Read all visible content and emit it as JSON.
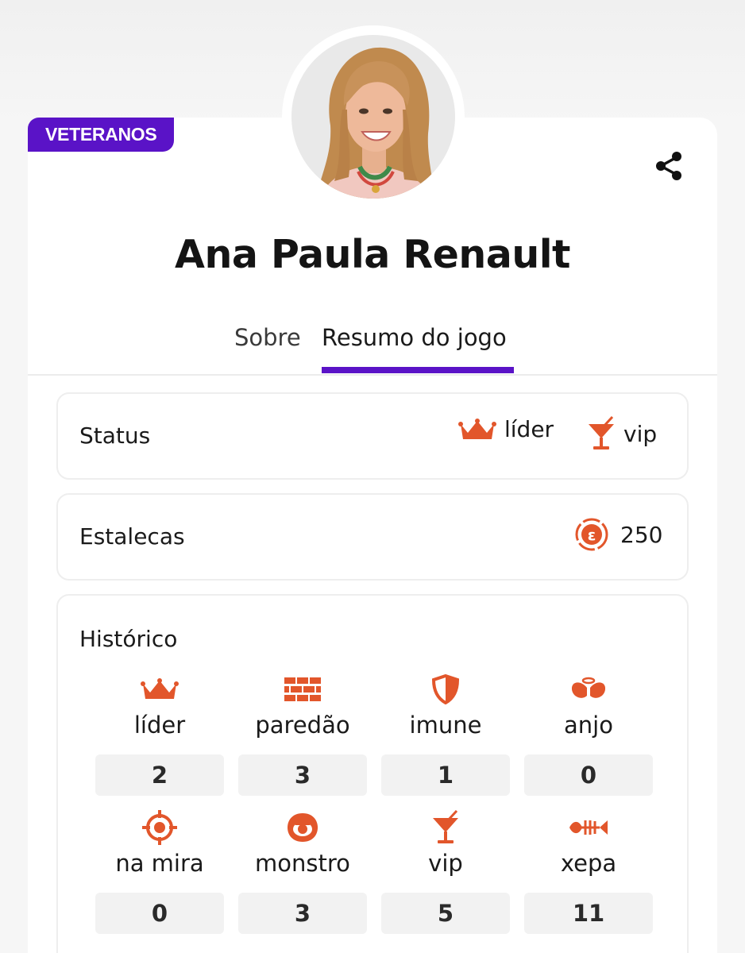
{
  "badge": "VETERANOS",
  "participant": {
    "name": "Ana Paula Renault"
  },
  "tabs": [
    {
      "label": "Sobre",
      "active": false
    },
    {
      "label": "Resumo do jogo",
      "active": true
    }
  ],
  "accent_color": "#5a13c7",
  "icon_color": "#e2562b",
  "status": {
    "label": "Status",
    "items": [
      {
        "label": "líder",
        "icon": "crown-icon"
      },
      {
        "label": "vip",
        "icon": "cocktail-icon"
      }
    ]
  },
  "estalecas": {
    "label": "Estalecas",
    "value": "250",
    "icon": "estaleca-coin-icon"
  },
  "historico": {
    "label": "Histórico",
    "stats": [
      {
        "label": "líder",
        "count": "2",
        "icon": "crown-icon"
      },
      {
        "label": "paredão",
        "count": "3",
        "icon": "brick-wall-icon"
      },
      {
        "label": "imune",
        "count": "1",
        "icon": "shield-icon"
      },
      {
        "label": "anjo",
        "count": "0",
        "icon": "angel-icon"
      },
      {
        "label": "na mira",
        "count": "0",
        "icon": "target-icon"
      },
      {
        "label": "monstro",
        "count": "3",
        "icon": "monster-eye-icon"
      },
      {
        "label": "vip",
        "count": "5",
        "icon": "cocktail-icon"
      },
      {
        "label": "xepa",
        "count": "11",
        "icon": "fishbone-icon"
      }
    ]
  }
}
